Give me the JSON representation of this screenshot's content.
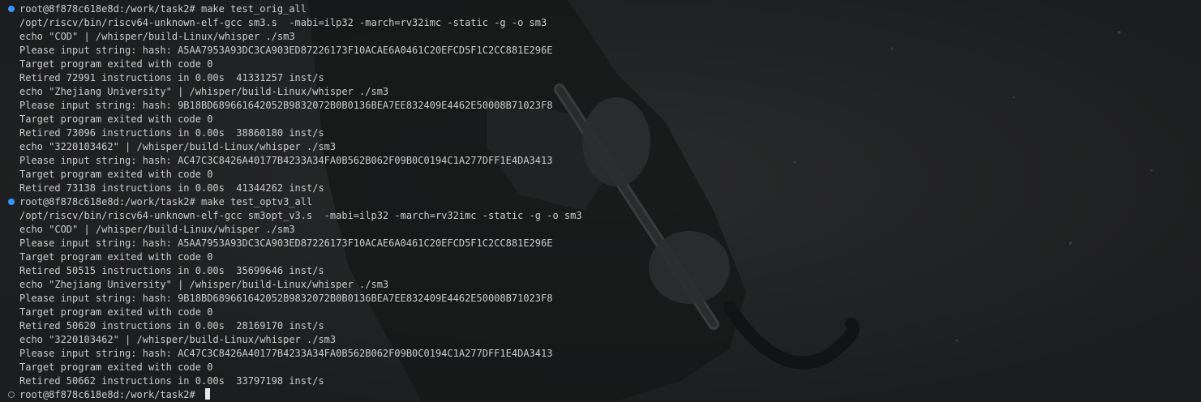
{
  "terminal": {
    "lines": [
      {
        "marker": "done",
        "text": "root@8f878c618e8d:/work/task2# make test_orig_all"
      },
      {
        "marker": null,
        "text": "/opt/riscv/bin/riscv64-unknown-elf-gcc sm3.s  -mabi=ilp32 -march=rv32imc -static -g -o sm3"
      },
      {
        "marker": null,
        "text": "echo \"COD\" | /whisper/build-Linux/whisper ./sm3"
      },
      {
        "marker": null,
        "text": "Please input string: hash: A5AA7953A93DC3CA903ED87226173F10ACAE6A0461C20EFCD5F1C2CC881E296E"
      },
      {
        "marker": null,
        "text": "Target program exited with code 0"
      },
      {
        "marker": null,
        "text": "Retired 72991 instructions in 0.00s  41331257 inst/s"
      },
      {
        "marker": null,
        "text": "echo \"Zhejiang University\" | /whisper/build-Linux/whisper ./sm3"
      },
      {
        "marker": null,
        "text": "Please input string: hash: 9B18BD689661642052B9832072B0B0136BEA7EE832409E4462E50008B71023F8"
      },
      {
        "marker": null,
        "text": "Target program exited with code 0"
      },
      {
        "marker": null,
        "text": "Retired 73096 instructions in 0.00s  38860180 inst/s"
      },
      {
        "marker": null,
        "text": "echo \"3220103462\" | /whisper/build-Linux/whisper ./sm3"
      },
      {
        "marker": null,
        "text": "Please input string: hash: AC47C3C8426A40177B4233A34FA0B562B062F09B0C0194C1A277DFF1E4DA3413"
      },
      {
        "marker": null,
        "text": "Target program exited with code 0"
      },
      {
        "marker": null,
        "text": "Retired 73138 instructions in 0.00s  41344262 inst/s"
      },
      {
        "marker": "done",
        "text": "root@8f878c618e8d:/work/task2# make test_optv3_all"
      },
      {
        "marker": null,
        "text": "/opt/riscv/bin/riscv64-unknown-elf-gcc sm3opt_v3.s  -mabi=ilp32 -march=rv32imc -static -g -o sm3"
      },
      {
        "marker": null,
        "text": "echo \"COD\" | /whisper/build-Linux/whisper ./sm3"
      },
      {
        "marker": null,
        "text": "Please input string: hash: A5AA7953A93DC3CA903ED87226173F10ACAE6A0461C20EFCD5F1C2CC881E296E"
      },
      {
        "marker": null,
        "text": "Target program exited with code 0"
      },
      {
        "marker": null,
        "text": "Retired 50515 instructions in 0.00s  35699646 inst/s"
      },
      {
        "marker": null,
        "text": "echo \"Zhejiang University\" | /whisper/build-Linux/whisper ./sm3"
      },
      {
        "marker": null,
        "text": "Please input string: hash: 9B18BD689661642052B9832072B0B0136BEA7EE832409E4462E50008B71023F8"
      },
      {
        "marker": null,
        "text": "Target program exited with code 0"
      },
      {
        "marker": null,
        "text": "Retired 50620 instructions in 0.00s  28169170 inst/s"
      },
      {
        "marker": null,
        "text": "echo \"3220103462\" | /whisper/build-Linux/whisper ./sm3"
      },
      {
        "marker": null,
        "text": "Please input string: hash: AC47C3C8426A40177B4233A34FA0B562B062F09B0C0194C1A277DFF1E4DA3413"
      },
      {
        "marker": null,
        "text": "Target program exited with code 0"
      },
      {
        "marker": null,
        "text": "Retired 50662 instructions in 0.00s  33797198 inst/s"
      },
      {
        "marker": "pending",
        "text": "root@8f878c618e8d:/work/task2# "
      }
    ]
  },
  "colors": {
    "background": "#1c1d1e",
    "text": "#cccccc",
    "marker_done": "#3794ff",
    "marker_pending": "#8a8a8a",
    "cursor": "#e6e6e6"
  },
  "icons": {
    "marker_done": "circle-filled-icon",
    "marker_pending": "circle-outline-icon"
  }
}
